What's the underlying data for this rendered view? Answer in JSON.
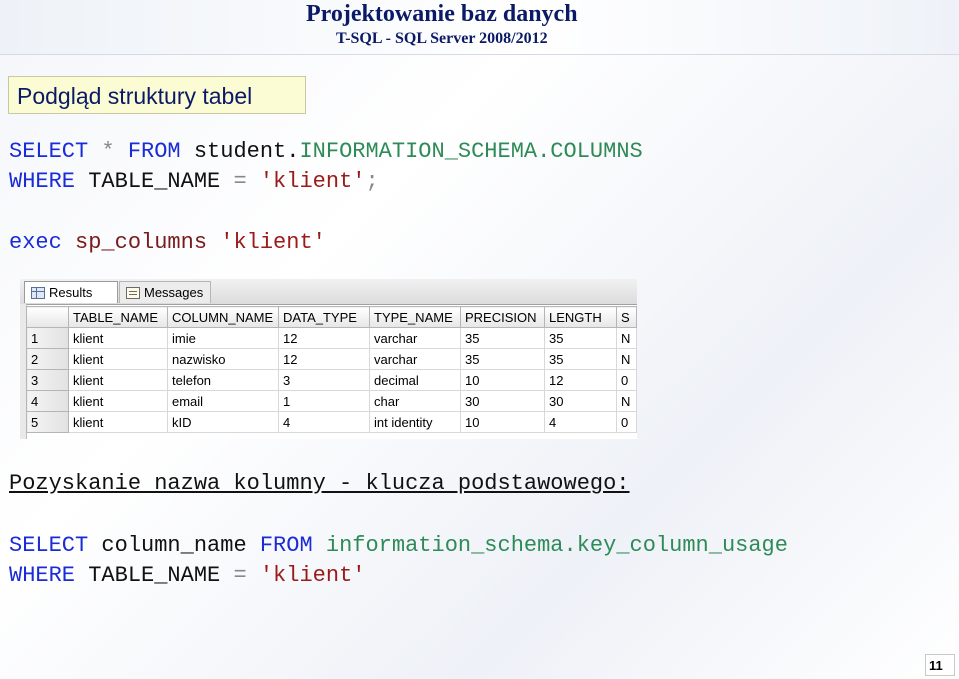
{
  "header": {
    "title": "Projektowanie baz danych",
    "subtitle": "T-SQL - SQL Server 2008/2012"
  },
  "section_label": "Podgląd struktury tabel",
  "query1": {
    "line1": {
      "kw1": "SELECT",
      "star": "*",
      "kw2": "FROM",
      "db": "student.",
      "schema": "INFORMATION_SCHEMA.COLUMNS"
    },
    "line2": {
      "kw": "WHERE",
      "col": "TABLE_NAME",
      "op": "=",
      "val": "'klient'",
      "end": ";"
    }
  },
  "query2": {
    "exec": "exec",
    "proc": "sp_columns",
    "val": "'klient'"
  },
  "results": {
    "tabs": [
      {
        "label": "Results",
        "icon": "grid-icon",
        "active": true
      },
      {
        "label": "Messages",
        "icon": "messages-icon",
        "active": false
      }
    ],
    "columns": [
      "TABLE_NAME",
      "COLUMN_NAME",
      "DATA_TYPE",
      "TYPE_NAME",
      "PRECISION",
      "LENGTH",
      "S"
    ],
    "rows": [
      {
        "num": "1",
        "cells": [
          "klient",
          "imie",
          "12",
          "varchar",
          "35",
          "35",
          "N"
        ]
      },
      {
        "num": "2",
        "cells": [
          "klient",
          "nazwisko",
          "12",
          "varchar",
          "35",
          "35",
          "N"
        ]
      },
      {
        "num": "3",
        "cells": [
          "klient",
          "telefon",
          "3",
          "decimal",
          "10",
          "12",
          "0"
        ]
      },
      {
        "num": "4",
        "cells": [
          "klient",
          "email",
          "1",
          "char",
          "30",
          "30",
          "N"
        ]
      },
      {
        "num": "5",
        "cells": [
          "klient",
          "kID",
          "4",
          "int identity",
          "10",
          "4",
          "0"
        ]
      }
    ]
  },
  "heading2": "Pozyskanie nazwa kolumny - klucza podstawowego:",
  "query3": {
    "line1": {
      "kw1": "SELECT",
      "col": "column_name",
      "kw2": "FROM",
      "view": "information_schema.key_column_usage"
    },
    "line2": {
      "kw": "WHERE",
      "col": "TABLE_NAME",
      "op": "=",
      "val": "'klient'"
    }
  },
  "page_number": "11"
}
